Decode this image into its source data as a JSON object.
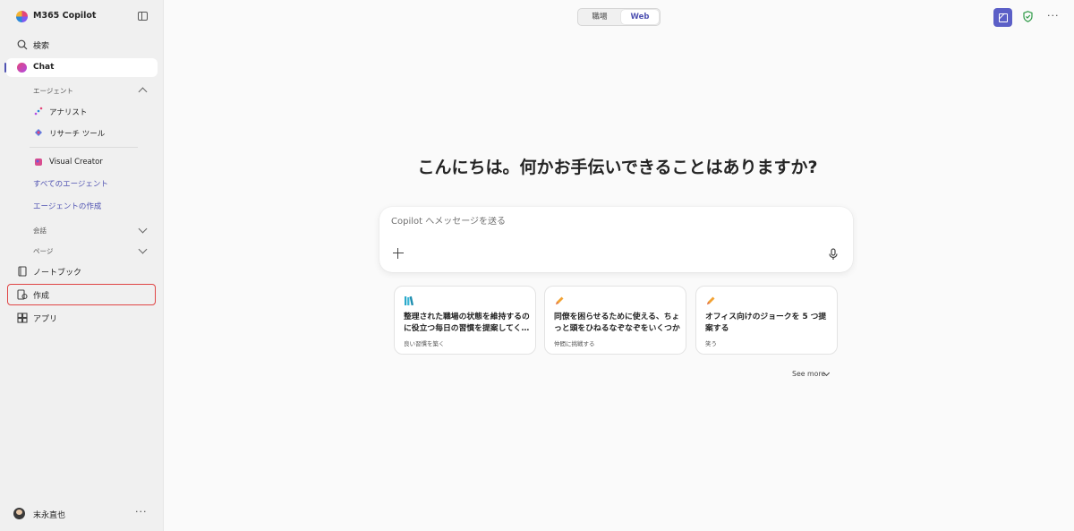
{
  "app": {
    "title": "M365 Copilot"
  },
  "sidebar": {
    "search_label": "検索",
    "chat_label": "Chat",
    "agents_section": "エージェント",
    "agents": [
      {
        "label": "アナリスト",
        "icon": "analyst-icon"
      },
      {
        "label": "リサーチ ツール",
        "icon": "research-tool-icon"
      },
      {
        "label": "Visual Creator",
        "icon": "visual-creator-icon"
      }
    ],
    "all_agents_link": "すべてのエージェント",
    "create_agent_link": "エージェントの作成",
    "conversations_section": "会話",
    "pages_section": "ページ",
    "notebook_label": "ノートブック",
    "create_label": "作成",
    "apps_label": "アプリ",
    "user_name": "末永直也"
  },
  "topbar": {
    "toggle": {
      "work": "職場",
      "web": "Web",
      "selected": "Web"
    }
  },
  "main": {
    "greeting": "こんにちは。何かお手伝いできることはありますか?",
    "composer_placeholder": "Copilot へメッセージを送る",
    "cards": [
      {
        "title": "整理された職場の状態を維持するのに役立つ毎日の習慣を提案してください",
        "subtitle": "良い習慣を築く",
        "icon": "books-icon"
      },
      {
        "title": "同僚を困らせるために使える、ちょっと頭をひねるなぞなぞをいくつか",
        "subtitle": "仲間に挑戦する",
        "icon": "pencil-icon"
      },
      {
        "title": "オフィス向けのジョークを 5 つ提案する",
        "subtitle": "笑う",
        "icon": "pencil-icon"
      }
    ],
    "see_more": "See more"
  },
  "colors": {
    "accent": "#5b5fc7",
    "link": "#4f52b2",
    "highlight": "#e04545",
    "shield": "#2e9a47"
  }
}
